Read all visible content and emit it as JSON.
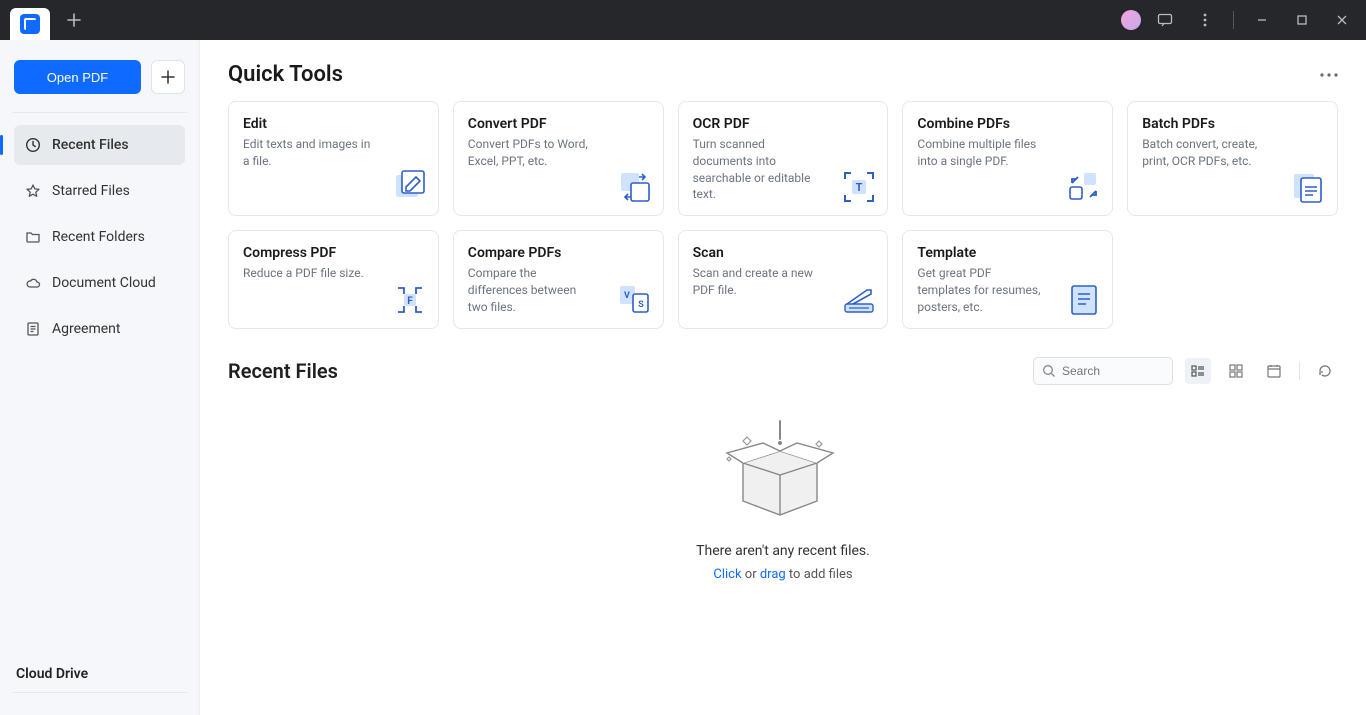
{
  "titlebar": {},
  "sidebar": {
    "open_label": "Open PDF",
    "items": [
      {
        "label": "Recent Files",
        "icon": "clock-icon",
        "active": true
      },
      {
        "label": "Starred Files",
        "icon": "star-icon",
        "active": false
      },
      {
        "label": "Recent Folders",
        "icon": "folder-icon",
        "active": false
      },
      {
        "label": "Document Cloud",
        "icon": "cloud-icon",
        "active": false
      },
      {
        "label": "Agreement",
        "icon": "doc-icon",
        "active": false
      }
    ],
    "cloud_title": "Cloud Drive"
  },
  "quick_tools": {
    "title": "Quick Tools",
    "cards": [
      {
        "title": "Edit",
        "desc": "Edit texts and images in a file."
      },
      {
        "title": "Convert PDF",
        "desc": "Convert PDFs to Word, Excel, PPT, etc."
      },
      {
        "title": "OCR PDF",
        "desc": "Turn scanned documents into searchable or editable text."
      },
      {
        "title": "Combine PDFs",
        "desc": "Combine multiple files into a single PDF."
      },
      {
        "title": "Batch PDFs",
        "desc": "Batch convert, create, print, OCR PDFs, etc."
      },
      {
        "title": "Compress PDF",
        "desc": "Reduce a PDF file size."
      },
      {
        "title": "Compare PDFs",
        "desc": "Compare the differences between two files."
      },
      {
        "title": "Scan",
        "desc": "Scan and create a new PDF file."
      },
      {
        "title": "Template",
        "desc": "Get great PDF templates for resumes, posters, etc."
      }
    ]
  },
  "recent": {
    "title": "Recent Files",
    "search_placeholder": "Search",
    "empty_main": "There aren't any recent files.",
    "empty_click": "Click",
    "empty_or": " or ",
    "empty_drag": "drag",
    "empty_suffix": " to add files"
  }
}
